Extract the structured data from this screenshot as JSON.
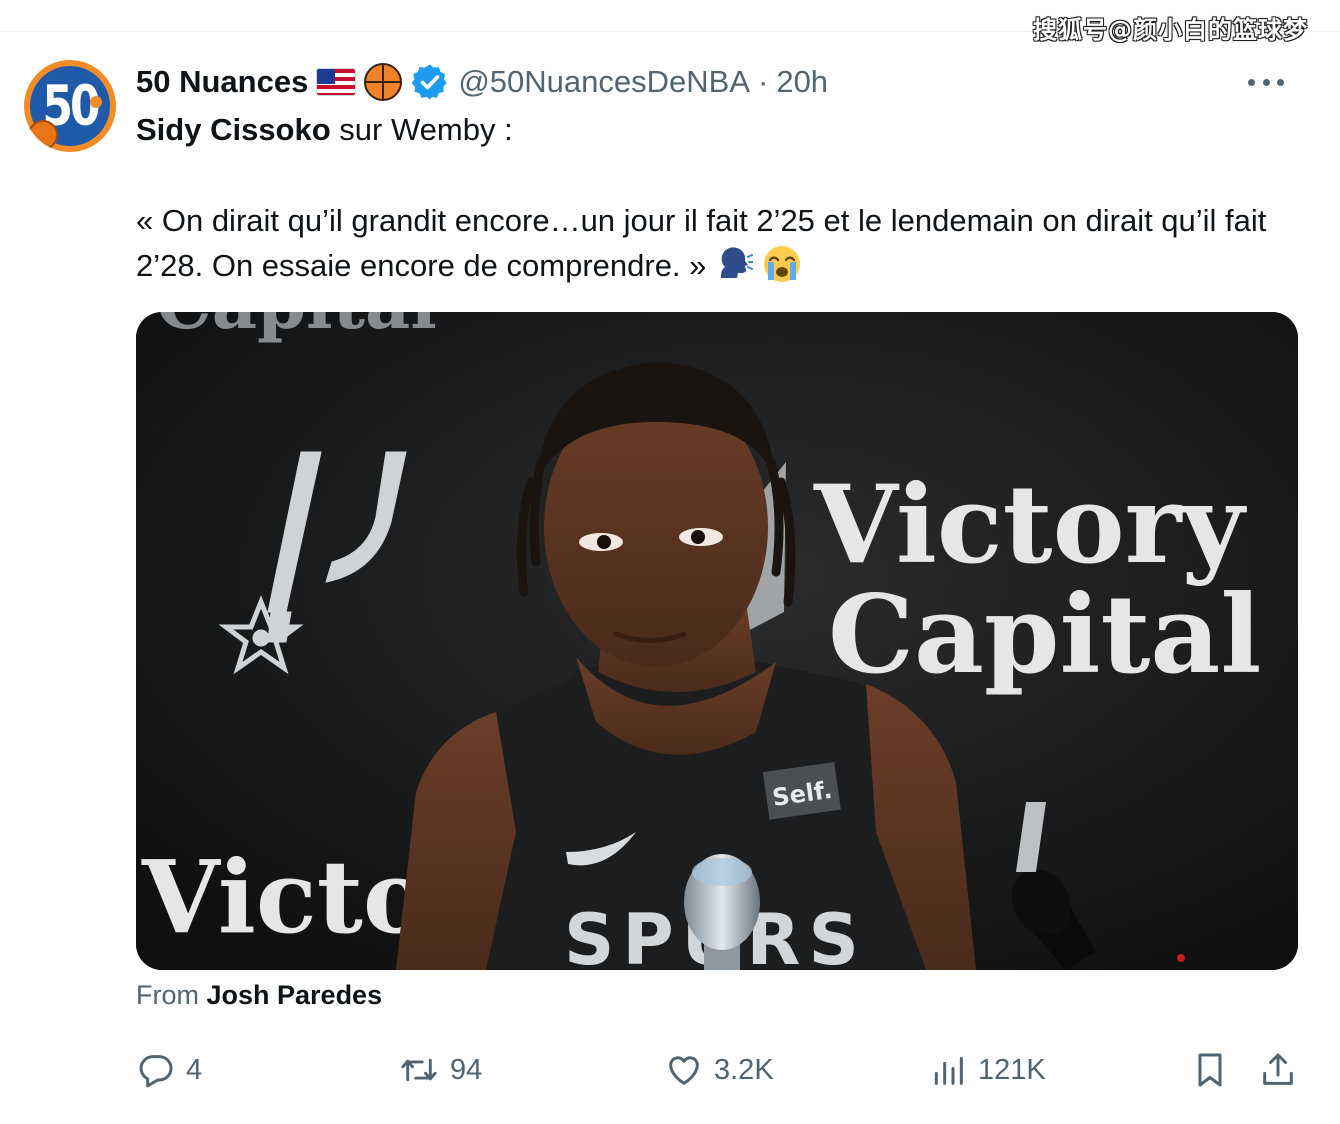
{
  "watermark": "搜狐号@颜小白的篮球梦",
  "tweet": {
    "avatar_text": "50",
    "display_name": "50 Nuances",
    "handle": "@50NuancesDeNBA",
    "separator": "·",
    "time": "20h",
    "line1_bold": "Sidy Cissoko",
    "line1_rest": " sur Wemby :",
    "quote_text": "« On dirait qu’il grandit encore…un jour il fait 2’25 et le lendemain on dirait qu’il fait 2’28. On essaie encore de comprendre. » ",
    "emojis": [
      "speaking-head-icon",
      "loudly-crying-face-icon"
    ]
  },
  "media": {
    "backdrop_text_1": "Victory",
    "backdrop_text_2": "Capital",
    "backdrop_text_3": "Victo",
    "jersey_text": "SPURS",
    "jersey_patch": "Self.",
    "colors": {
      "backdrop": "#121314",
      "jersey": "#1c1d1f",
      "skin": "#5a3322"
    }
  },
  "caption": {
    "prefix": "From ",
    "author": "Josh Paredes"
  },
  "actions": {
    "replies": "4",
    "reposts": "94",
    "likes": "3.2K",
    "views": "121K"
  },
  "colors": {
    "accent_verified": "#1d9bf0",
    "text_secondary": "#536471",
    "text_primary": "#0f1419"
  }
}
